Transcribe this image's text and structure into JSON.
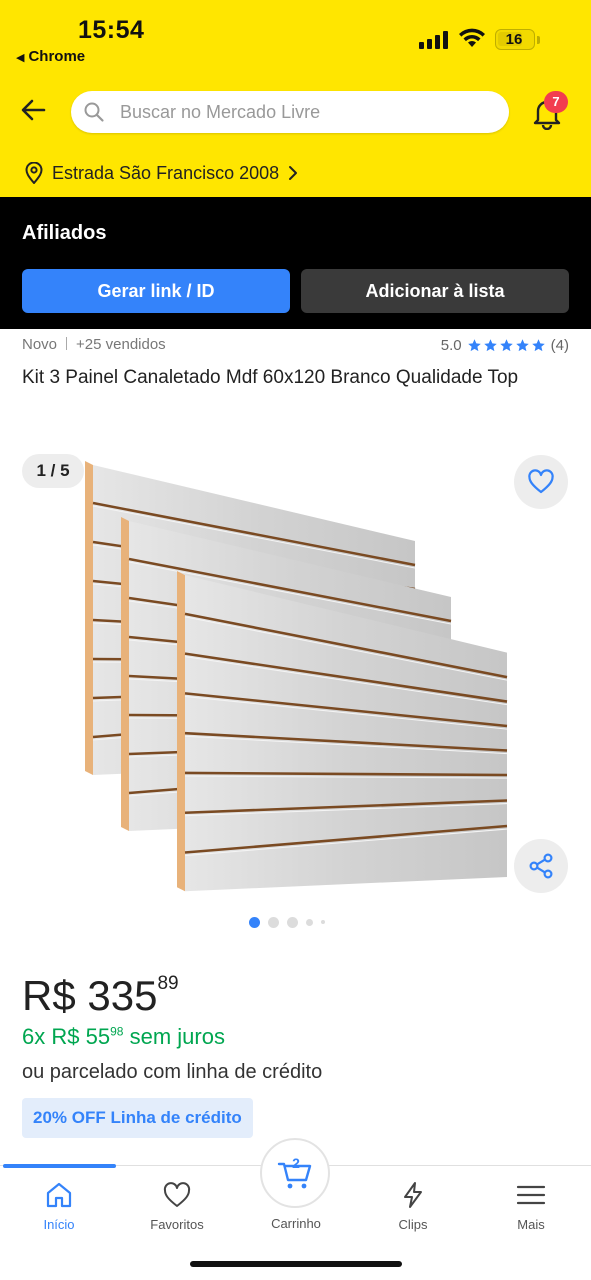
{
  "status_bar": {
    "time": "15:54",
    "back_app": "Chrome",
    "battery": "16"
  },
  "header": {
    "search_placeholder": "Buscar no Mercado Livre",
    "notification_count": "7",
    "location": "Estrada São Francisco 2008"
  },
  "affiliates": {
    "title": "Afiliados",
    "generate_link_label": "Gerar link / ID",
    "add_to_list_label": "Adicionar à lista"
  },
  "product": {
    "condition": "Novo",
    "sold": "+25 vendidos",
    "rating": "5.0",
    "rating_stars": 5,
    "reviews": "(4)",
    "title": "Kit 3 Painel Canaletado Mdf 60x120 Branco Qualidade Top",
    "gallery_counter": "1 / 5",
    "gallery_total": 5,
    "gallery_current": 1
  },
  "price": {
    "currency": "R$",
    "integer": "335",
    "cents": "89",
    "installment_count": "6x",
    "installment_currency": "R$",
    "installment_integer": "55",
    "installment_cents": "98",
    "installment_suffix": "sem juros",
    "credit_text": "ou parcelado com linha de crédito",
    "off_badge": "20% OFF Linha de crédito"
  },
  "nav": {
    "items": [
      {
        "label": "Início",
        "icon": "home-icon",
        "active": true
      },
      {
        "label": "Favoritos",
        "icon": "heart-icon",
        "active": false
      },
      {
        "label": "Carrinho",
        "icon": "cart-icon",
        "active": false,
        "count": "2"
      },
      {
        "label": "Clips",
        "icon": "lightning-icon",
        "active": false
      },
      {
        "label": "Mais",
        "icon": "menu-icon",
        "active": false
      }
    ]
  },
  "colors": {
    "brand_yellow": "#FFE600",
    "accent_blue": "#3483FA",
    "price_green": "#00A650",
    "badge_red": "#F23D4F"
  }
}
